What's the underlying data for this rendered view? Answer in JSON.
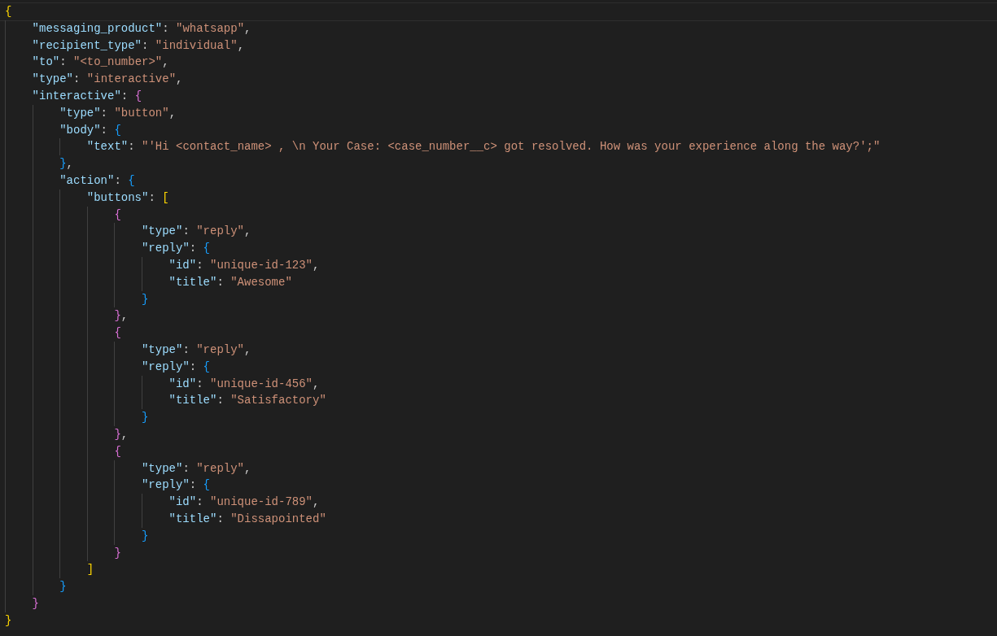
{
  "editor": {
    "lines": [
      {
        "current": true,
        "tokens": [
          {
            "kind": "bracket",
            "text": "{",
            "color": "#ffd700"
          }
        ],
        "children": [
          {
            "current": false,
            "tokens": [
              {
                "kind": "key",
                "text": "\"messaging_product\""
              },
              {
                "kind": "punct",
                "text": ": "
              },
              {
                "kind": "str",
                "text": "\"whatsapp\""
              },
              {
                "kind": "punct",
                "text": ","
              }
            ]
          },
          {
            "current": false,
            "tokens": [
              {
                "kind": "key",
                "text": "\"recipient_type\""
              },
              {
                "kind": "punct",
                "text": ": "
              },
              {
                "kind": "str",
                "text": "\"individual\""
              },
              {
                "kind": "punct",
                "text": ","
              }
            ]
          },
          {
            "current": false,
            "tokens": [
              {
                "kind": "key",
                "text": "\"to\""
              },
              {
                "kind": "punct",
                "text": ": "
              },
              {
                "kind": "str",
                "text": "\"<to_number>\""
              },
              {
                "kind": "punct",
                "text": ","
              }
            ]
          },
          {
            "current": false,
            "tokens": [
              {
                "kind": "key",
                "text": "\"type\""
              },
              {
                "kind": "punct",
                "text": ": "
              },
              {
                "kind": "str",
                "text": "\"interactive\""
              },
              {
                "kind": "punct",
                "text": ","
              }
            ]
          },
          {
            "current": false,
            "tokens": [
              {
                "kind": "key",
                "text": "\"interactive\""
              },
              {
                "kind": "punct",
                "text": ": "
              },
              {
                "kind": "bracket",
                "text": "{",
                "color": "#da70d6"
              }
            ],
            "children": [
              {
                "current": false,
                "tokens": [
                  {
                    "kind": "key",
                    "text": "\"type\""
                  },
                  {
                    "kind": "punct",
                    "text": ": "
                  },
                  {
                    "kind": "str",
                    "text": "\"button\""
                  },
                  {
                    "kind": "punct",
                    "text": ","
                  }
                ]
              },
              {
                "current": false,
                "tokens": [
                  {
                    "kind": "key",
                    "text": "\"body\""
                  },
                  {
                    "kind": "punct",
                    "text": ": "
                  },
                  {
                    "kind": "bracket",
                    "text": "{",
                    "color": "#179fff"
                  }
                ],
                "children": [
                  {
                    "current": false,
                    "tokens": [
                      {
                        "kind": "key",
                        "text": "\"text\""
                      },
                      {
                        "kind": "punct",
                        "text": ": "
                      },
                      {
                        "kind": "str",
                        "text": "\"'Hi <contact_name> , \\n Your Case: <case_number__c> got resolved. How was your experience along the way?';\""
                      }
                    ]
                  }
                ]
              },
              {
                "current": false,
                "tokens": [
                  {
                    "kind": "bracket",
                    "text": "}",
                    "color": "#179fff"
                  },
                  {
                    "kind": "punct",
                    "text": ","
                  }
                ]
              },
              {
                "current": false,
                "tokens": [
                  {
                    "kind": "key",
                    "text": "\"action\""
                  },
                  {
                    "kind": "punct",
                    "text": ": "
                  },
                  {
                    "kind": "bracket",
                    "text": "{",
                    "color": "#179fff"
                  }
                ],
                "children": [
                  {
                    "current": false,
                    "tokens": [
                      {
                        "kind": "key",
                        "text": "\"buttons\""
                      },
                      {
                        "kind": "punct",
                        "text": ": "
                      },
                      {
                        "kind": "bracket",
                        "text": "[",
                        "color": "#ffd700"
                      }
                    ],
                    "children": [
                      {
                        "current": false,
                        "tokens": [
                          {
                            "kind": "bracket",
                            "text": "{",
                            "color": "#da70d6"
                          }
                        ],
                        "children": [
                          {
                            "current": false,
                            "tokens": [
                              {
                                "kind": "key",
                                "text": "\"type\""
                              },
                              {
                                "kind": "punct",
                                "text": ": "
                              },
                              {
                                "kind": "str",
                                "text": "\"reply\""
                              },
                              {
                                "kind": "punct",
                                "text": ","
                              }
                            ]
                          },
                          {
                            "current": false,
                            "tokens": [
                              {
                                "kind": "key",
                                "text": "\"reply\""
                              },
                              {
                                "kind": "punct",
                                "text": ": "
                              },
                              {
                                "kind": "bracket",
                                "text": "{",
                                "color": "#179fff"
                              }
                            ],
                            "children": [
                              {
                                "current": false,
                                "tokens": [
                                  {
                                    "kind": "key",
                                    "text": "\"id\""
                                  },
                                  {
                                    "kind": "punct",
                                    "text": ": "
                                  },
                                  {
                                    "kind": "str",
                                    "text": "\"unique-id-123\""
                                  },
                                  {
                                    "kind": "punct",
                                    "text": ","
                                  }
                                ]
                              },
                              {
                                "current": false,
                                "tokens": [
                                  {
                                    "kind": "key",
                                    "text": "\"title\""
                                  },
                                  {
                                    "kind": "punct",
                                    "text": ": "
                                  },
                                  {
                                    "kind": "str",
                                    "text": "\"Awesome\""
                                  }
                                ]
                              }
                            ]
                          },
                          {
                            "current": false,
                            "tokens": [
                              {
                                "kind": "bracket",
                                "text": "}",
                                "color": "#179fff"
                              }
                            ]
                          }
                        ]
                      },
                      {
                        "current": false,
                        "tokens": [
                          {
                            "kind": "bracket",
                            "text": "}",
                            "color": "#da70d6"
                          },
                          {
                            "kind": "punct",
                            "text": ","
                          }
                        ]
                      },
                      {
                        "current": false,
                        "tokens": [
                          {
                            "kind": "bracket",
                            "text": "{",
                            "color": "#da70d6"
                          }
                        ],
                        "children": [
                          {
                            "current": false,
                            "tokens": [
                              {
                                "kind": "key",
                                "text": "\"type\""
                              },
                              {
                                "kind": "punct",
                                "text": ": "
                              },
                              {
                                "kind": "str",
                                "text": "\"reply\""
                              },
                              {
                                "kind": "punct",
                                "text": ","
                              }
                            ]
                          },
                          {
                            "current": false,
                            "tokens": [
                              {
                                "kind": "key",
                                "text": "\"reply\""
                              },
                              {
                                "kind": "punct",
                                "text": ": "
                              },
                              {
                                "kind": "bracket",
                                "text": "{",
                                "color": "#179fff"
                              }
                            ],
                            "children": [
                              {
                                "current": false,
                                "tokens": [
                                  {
                                    "kind": "key",
                                    "text": "\"id\""
                                  },
                                  {
                                    "kind": "punct",
                                    "text": ": "
                                  },
                                  {
                                    "kind": "str",
                                    "text": "\"unique-id-456\""
                                  },
                                  {
                                    "kind": "punct",
                                    "text": ","
                                  }
                                ]
                              },
                              {
                                "current": false,
                                "tokens": [
                                  {
                                    "kind": "key",
                                    "text": "\"title\""
                                  },
                                  {
                                    "kind": "punct",
                                    "text": ": "
                                  },
                                  {
                                    "kind": "str",
                                    "text": "\"Satisfactory\""
                                  }
                                ]
                              }
                            ]
                          },
                          {
                            "current": false,
                            "tokens": [
                              {
                                "kind": "bracket",
                                "text": "}",
                                "color": "#179fff"
                              }
                            ]
                          }
                        ]
                      },
                      {
                        "current": false,
                        "tokens": [
                          {
                            "kind": "bracket",
                            "text": "}",
                            "color": "#da70d6"
                          },
                          {
                            "kind": "punct",
                            "text": ","
                          }
                        ]
                      },
                      {
                        "current": false,
                        "tokens": [
                          {
                            "kind": "bracket",
                            "text": "{",
                            "color": "#da70d6"
                          }
                        ],
                        "children": [
                          {
                            "current": false,
                            "tokens": [
                              {
                                "kind": "key",
                                "text": "\"type\""
                              },
                              {
                                "kind": "punct",
                                "text": ": "
                              },
                              {
                                "kind": "str",
                                "text": "\"reply\""
                              },
                              {
                                "kind": "punct",
                                "text": ","
                              }
                            ]
                          },
                          {
                            "current": false,
                            "tokens": [
                              {
                                "kind": "key",
                                "text": "\"reply\""
                              },
                              {
                                "kind": "punct",
                                "text": ": "
                              },
                              {
                                "kind": "bracket",
                                "text": "{",
                                "color": "#179fff"
                              }
                            ],
                            "children": [
                              {
                                "current": false,
                                "tokens": [
                                  {
                                    "kind": "key",
                                    "text": "\"id\""
                                  },
                                  {
                                    "kind": "punct",
                                    "text": ": "
                                  },
                                  {
                                    "kind": "str",
                                    "text": "\"unique-id-789\""
                                  },
                                  {
                                    "kind": "punct",
                                    "text": ","
                                  }
                                ]
                              },
                              {
                                "current": false,
                                "tokens": [
                                  {
                                    "kind": "key",
                                    "text": "\"title\""
                                  },
                                  {
                                    "kind": "punct",
                                    "text": ": "
                                  },
                                  {
                                    "kind": "str",
                                    "text": "\"Dissapointed\""
                                  }
                                ]
                              }
                            ]
                          },
                          {
                            "current": false,
                            "tokens": [
                              {
                                "kind": "bracket",
                                "text": "}",
                                "color": "#179fff"
                              }
                            ]
                          }
                        ]
                      },
                      {
                        "current": false,
                        "tokens": [
                          {
                            "kind": "bracket",
                            "text": "}",
                            "color": "#da70d6"
                          }
                        ]
                      }
                    ]
                  },
                  {
                    "current": false,
                    "tokens": [
                      {
                        "kind": "bracket",
                        "text": "]",
                        "color": "#ffd700"
                      }
                    ]
                  }
                ]
              },
              {
                "current": false,
                "tokens": [
                  {
                    "kind": "bracket",
                    "text": "}",
                    "color": "#179fff"
                  }
                ]
              }
            ]
          },
          {
            "current": false,
            "tokens": [
              {
                "kind": "bracket",
                "text": "}",
                "color": "#da70d6"
              }
            ]
          }
        ]
      },
      {
        "current": false,
        "tokens": [
          {
            "kind": "bracket",
            "text": "}",
            "color": "#ffd700"
          }
        ]
      }
    ]
  }
}
